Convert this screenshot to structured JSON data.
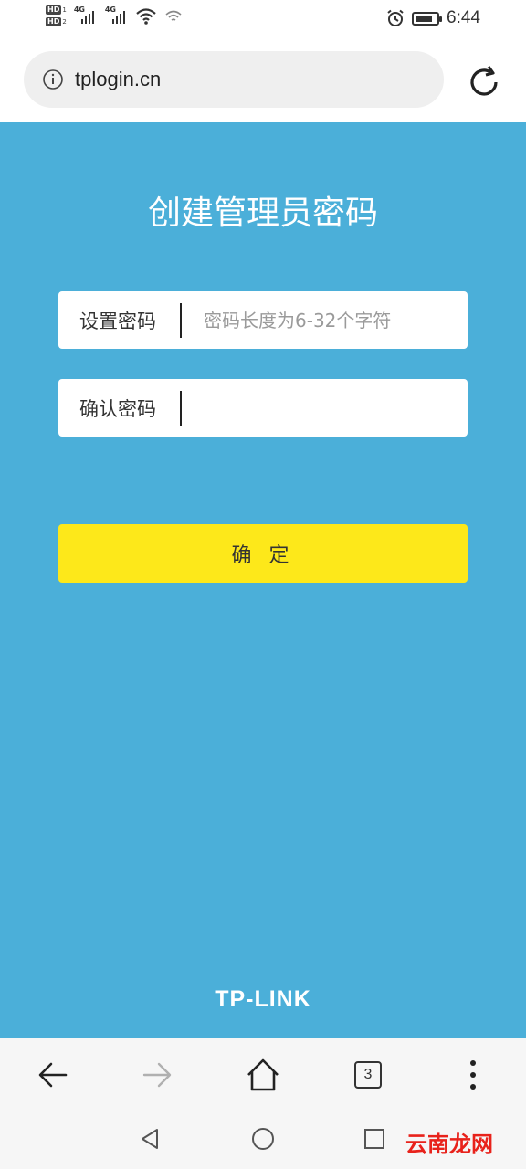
{
  "status_bar": {
    "hd_1": "HD",
    "hd_1_num": "1",
    "hd_2": "HD",
    "hd_2_num": "2",
    "sig_1": "4G",
    "sig_2": "4G",
    "time": "6:44",
    "battery_level": 0.8
  },
  "browser": {
    "url": "tplogin.cn",
    "tab_count": "3"
  },
  "page": {
    "title": "创建管理员密码",
    "password_label": "设置密码",
    "password_placeholder": "密码长度为6-32个字符",
    "confirm_label": "确认密码",
    "confirm_placeholder": "",
    "submit_label": "确 定",
    "logo_text": "TP-LINK"
  },
  "watermark": "云南龙网",
  "colors": {
    "background": "#4bafd9",
    "button": "#fde81a",
    "watermark": "#e8221b"
  }
}
